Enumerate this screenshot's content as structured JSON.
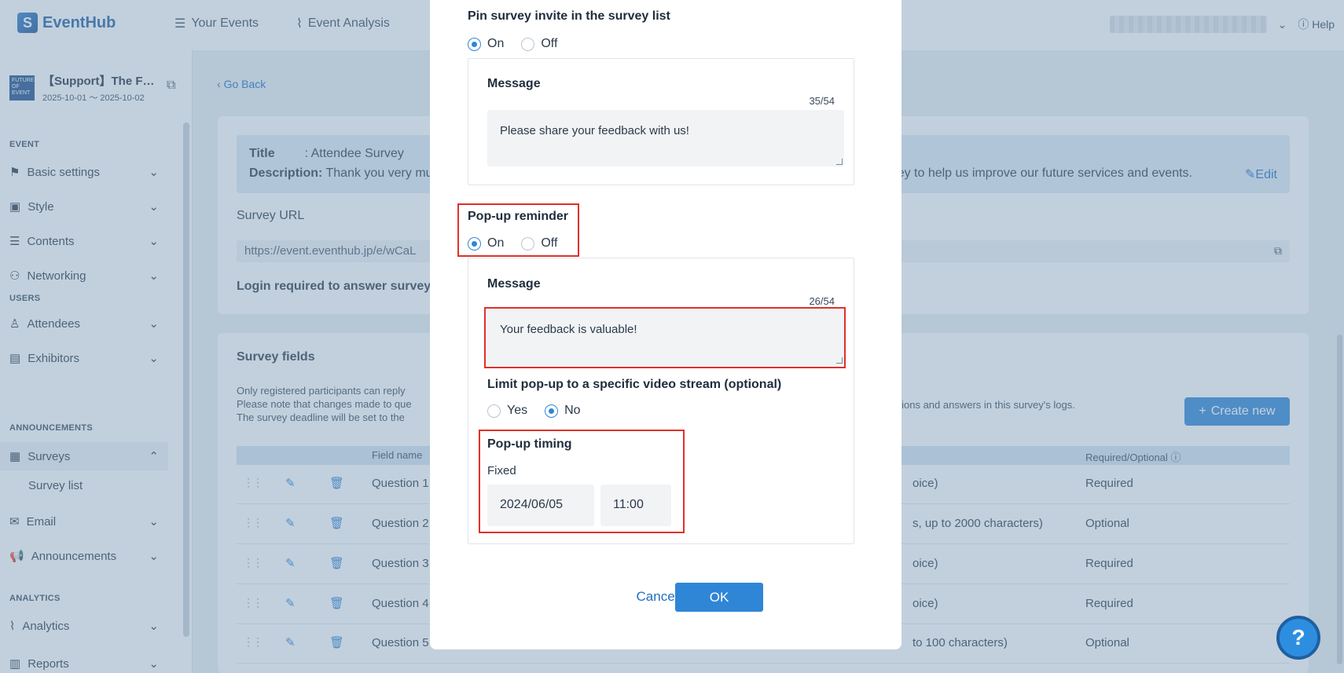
{
  "app": {
    "logo_text": "EventHub",
    "nav": [
      {
        "label": "Your Events",
        "icon": "list-icon"
      },
      {
        "label": "Event Analysis",
        "icon": "chart-icon"
      }
    ],
    "help_label": "Help"
  },
  "sidebar": {
    "event_title": "【Support】The F…",
    "event_dates": "2025-10-01 ～ 2025-10-02",
    "thumb_text": "FUTURE OF EVENT",
    "sections": {
      "event": "EVENT",
      "users": "USERS",
      "announcements": "ANNOUNCEMENTS",
      "analytics": "ANALYTICS"
    },
    "items": {
      "basic_settings": "Basic settings",
      "style": "Style",
      "contents": "Contents",
      "networking": "Networking",
      "attendees": "Attendees",
      "exhibitors": "Exhibitors",
      "surveys": "Surveys",
      "survey_list": "Survey list",
      "email": "Email",
      "announcements": "Announcements",
      "analytics": "Analytics",
      "reports": "Reports"
    }
  },
  "main": {
    "go_back": "Go Back",
    "title_label": "Title",
    "title_value": ": Attendee Survey",
    "description_label": "Description:",
    "description_start": "Thank you very mu",
    "description_tail": "ey to help us improve our future services and events.",
    "edit": "Edit",
    "survey_url_label": "Survey URL",
    "survey_url": "https://event.eventhub.jp/e/wCaL",
    "login_label": "Login required to answer survey",
    "fields_title": "Survey fields",
    "notes": [
      "Only registered participants can reply",
      "Please note that changes made to que",
      "The survey deadline will be set to the"
    ],
    "note_tail": "stions and answers in this survey's logs.",
    "create_new": "Create new",
    "col_field_name": "Field name",
    "col_required": "Required/Optional",
    "rows": [
      {
        "name": "Question 1",
        "type": "oice)",
        "req": "Required"
      },
      {
        "name": "Question 2",
        "type": "s, up to 2000 characters)",
        "req": "Optional"
      },
      {
        "name": "Question 3",
        "type": "oice)",
        "req": "Required"
      },
      {
        "name": "Question 4",
        "type": "oice)",
        "req": "Required"
      },
      {
        "name": "Question 5",
        "type": "to 100 characters)",
        "req": "Optional"
      }
    ]
  },
  "modal": {
    "pin_heading": "Pin survey invite in the survey list",
    "on": "On",
    "off": "Off",
    "message_heading": "Message",
    "pin_counter": "35/54",
    "pin_message": "Please share your feedback with us!",
    "popup_heading": "Pop-up reminder",
    "popup_counter": "26/54",
    "popup_message": "Your feedback is valuable!",
    "limit_heading": "Limit pop-up to a specific video stream (optional)",
    "yes": "Yes",
    "no": "No",
    "timing_heading": "Pop-up timing",
    "fixed": "Fixed",
    "date": "2024/06/05",
    "time": "11:00",
    "cancel": "Cancel",
    "ok": "OK",
    "states": {
      "pin": "On",
      "popup": "On",
      "limit": "No"
    },
    "highlight_color": "#e0302a"
  }
}
